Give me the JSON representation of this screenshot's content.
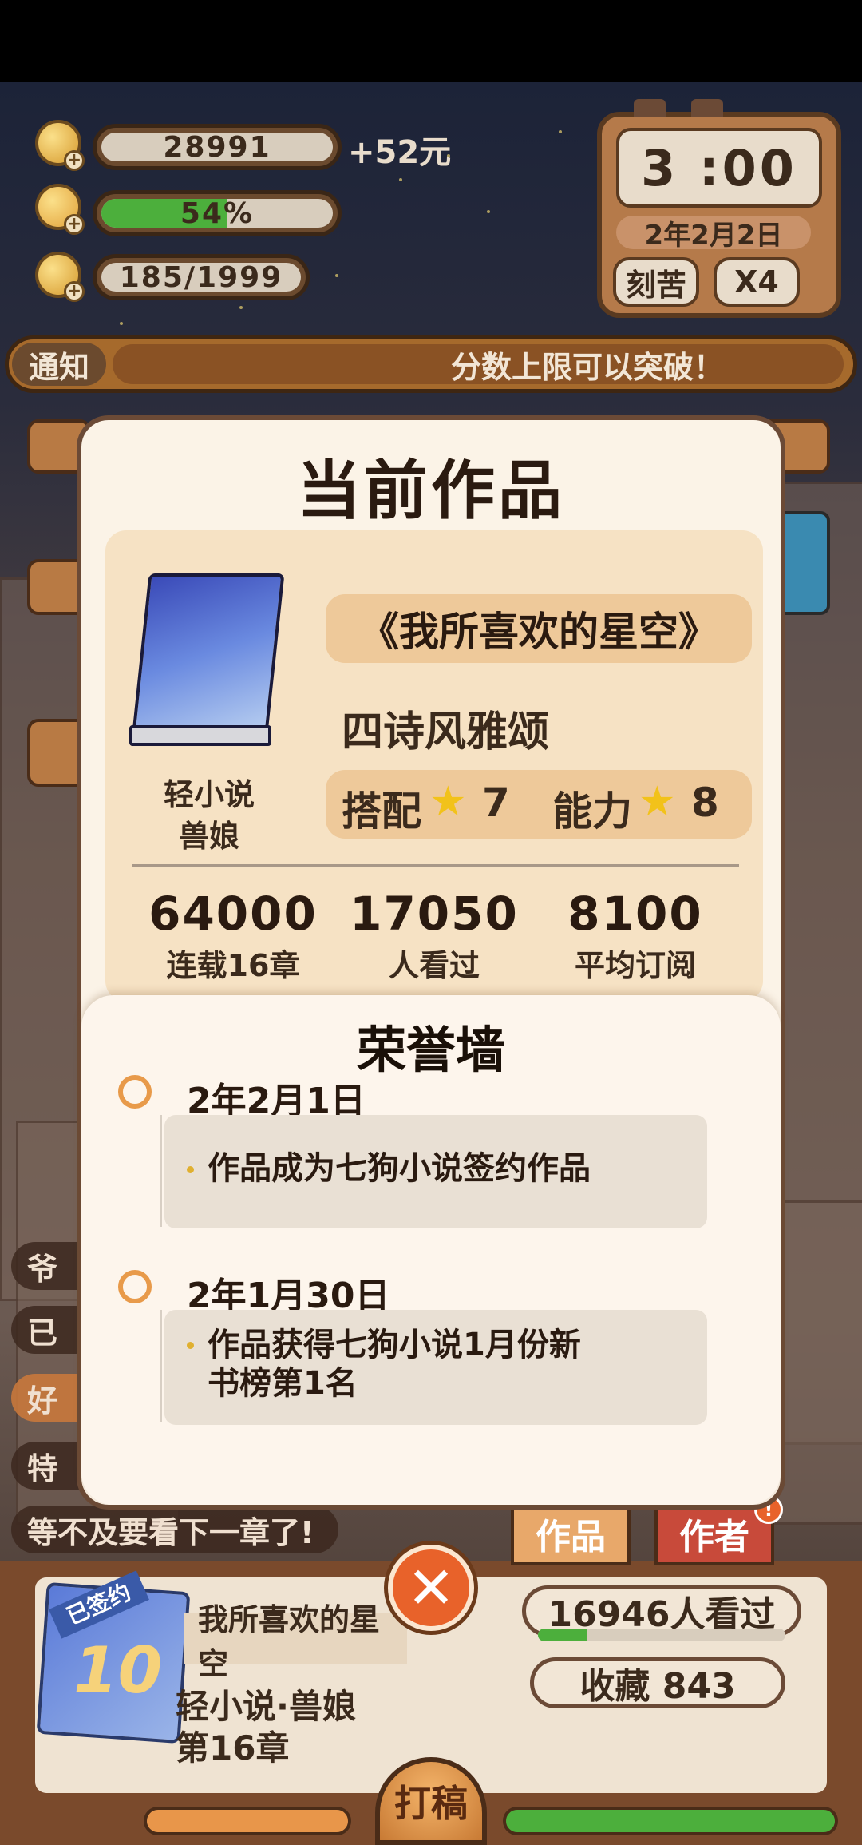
{
  "hud": {
    "coins": "28991",
    "income": "+52元",
    "energy": "54%",
    "energy_fraction": 0.54,
    "inspiration": "185/1999"
  },
  "clock": {
    "time": "3 :00",
    "date": "2年2月2日",
    "mode": "刻苦",
    "speed": "X4"
  },
  "notice": {
    "label": "通知",
    "text": "分数上限可以突破！"
  },
  "modal": {
    "title": "当前作品",
    "book_title": "《我所喜欢的星空》",
    "tagline": "四诗风雅颂",
    "genre1": "轻小说",
    "genre2": "兽娘",
    "match_label": "搭配",
    "match_value": "7",
    "ability_label": "能力",
    "ability_value": "8",
    "stats": [
      {
        "value": "64000",
        "label": "连载16章"
      },
      {
        "value": "17050",
        "label": "人看过"
      },
      {
        "value": "8100",
        "label": "平均订阅"
      }
    ]
  },
  "honor": {
    "title": "荣誉墙",
    "entries": [
      {
        "date": "2年2月1日",
        "text": "作品成为七狗小说签约作品"
      },
      {
        "date": "2年1月30日",
        "text": "作品获得七狗小说1月份新书榜第1名"
      }
    ]
  },
  "side_chips": {
    "last": "等不及要看下一章了!"
  },
  "bottom": {
    "tab_works": "作品",
    "tab_author": "作者",
    "signed_badge": "已签约",
    "chapter_num": "10",
    "book_name": "我所喜欢的星空",
    "genre_line": "轻小说·兽娘",
    "chapter_line": "第16章",
    "viewers": "16946人看过",
    "viewers_fraction": 0.2,
    "favorites": "收藏 843",
    "write_button": "打稿"
  },
  "colors": {
    "accent_orange": "#e8622a",
    "modal_bg": "#fbf3e7",
    "brown_border": "#6b4a36",
    "energy_green": "#4caf3c"
  }
}
